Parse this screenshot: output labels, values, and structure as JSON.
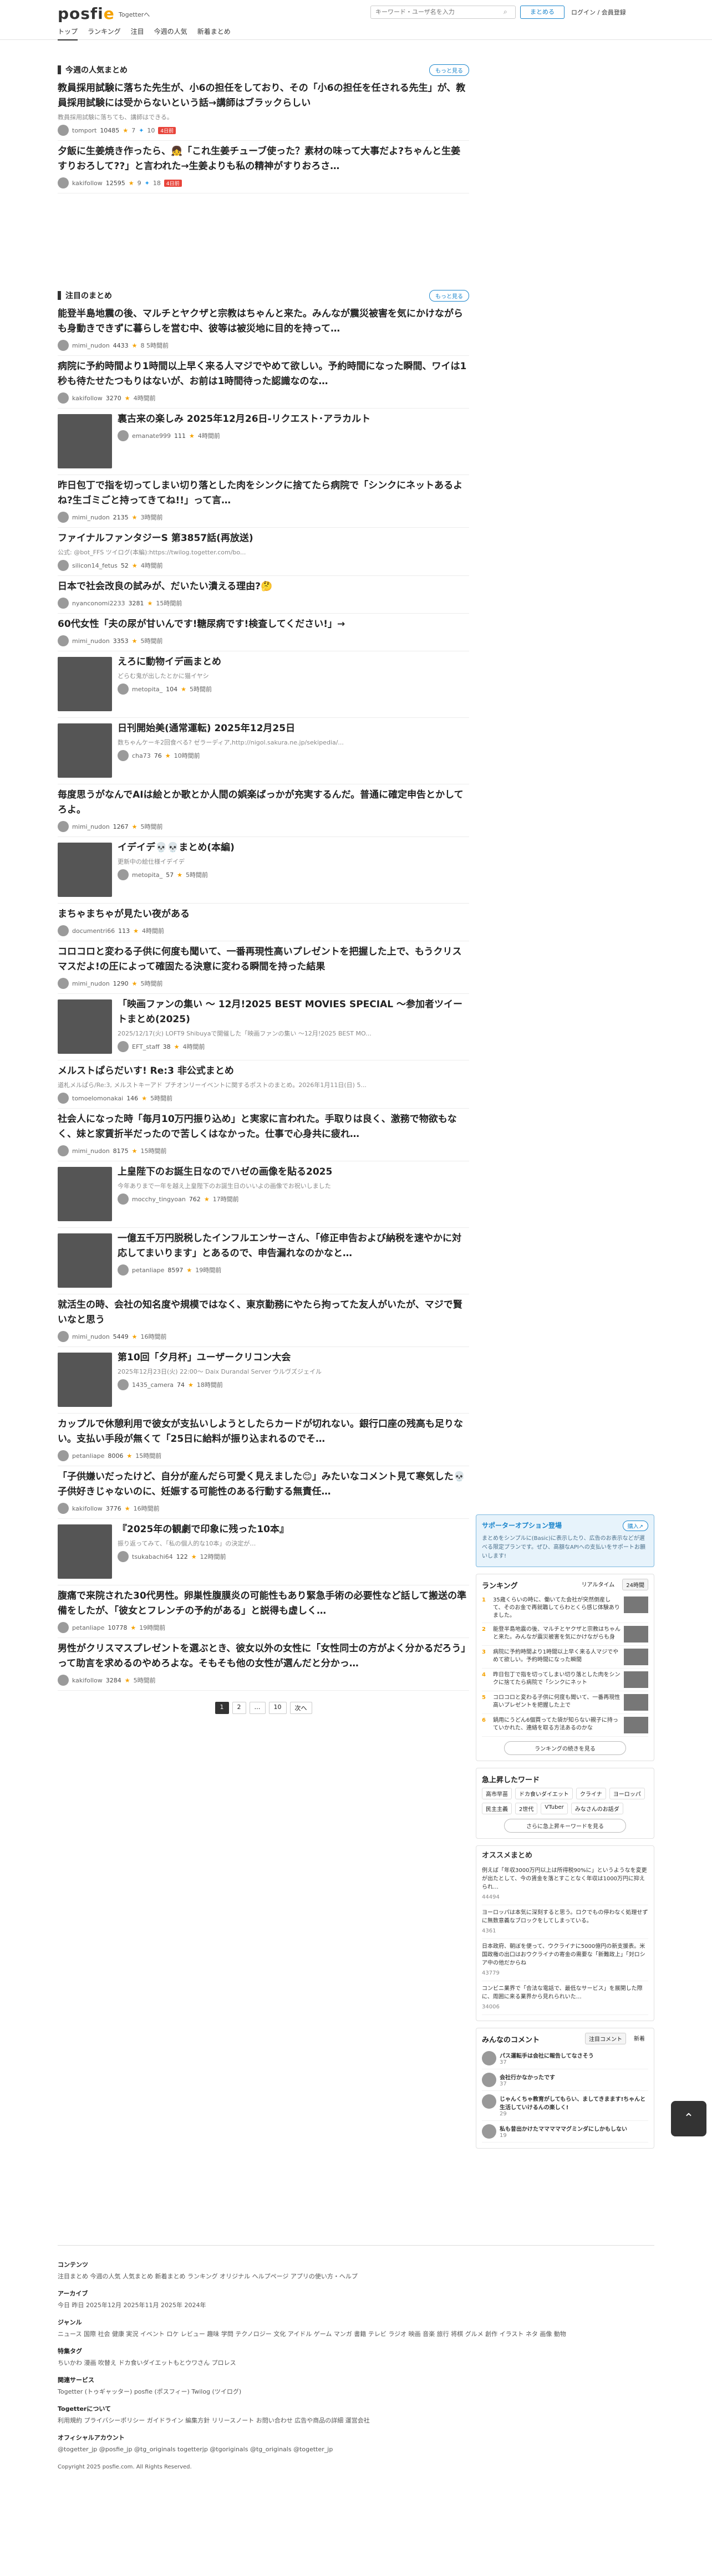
{
  "header": {
    "logo": "posfie",
    "by": "Togetterへ",
    "search_placeholder": "キーワード・ユーザ名を入力",
    "more_button": "まとめる",
    "login": "ログイン / 会員登録",
    "nav": [
      "トップ",
      "ランキング",
      "注目",
      "今週の人気",
      "新着まとめ"
    ]
  },
  "weekly": {
    "title": "今週の人気まとめ",
    "more": "もっと見る",
    "items": [
      {
        "headline": "教員採用試験に落ちた先生が、小6の担任をしており、その「小6の担任を任される先生」が、教員採用試験には受からないという話→講師はブラックらしい",
        "desc": "教員採用試験に落ちても、講師はできる。",
        "user": "tomport",
        "views": "10485",
        "stars": "7",
        "tweets": "10",
        "hot": "4日前"
      },
      {
        "headline": "夕飯に生姜焼き作ったら、👧「これ生姜チューブ使った？素材の味って大事だよ?ちゃんと生姜すりおろして??」と言われた→生姜よりも私の精神がすりおろさ…",
        "desc": "",
        "user": "kakifollow",
        "views": "12595",
        "stars": "9",
        "tweets": "18",
        "hot": "4日前"
      }
    ]
  },
  "attention": {
    "title": "注目のまとめ",
    "more": "もっと見る",
    "items": [
      {
        "headline": "能登半島地震の後、マルチとヤクザと宗教はちゃんと来た。みんなが震災被害を気にかけながらも身動きできずに暮らしを営む中、彼等は被災地に目的を持って…",
        "user": "mimi_nudon",
        "views": "4433",
        "meta": "8 5時間前"
      },
      {
        "headline": "病院に予約時間より1時間以上早く来る人マジでやめて欲しい。予約時間になった瞬間、ワイは1秒も待たせたつもりはないが、お前は1時間待った認識なのな…",
        "user": "kakifollow",
        "views": "3270",
        "meta": "4時間前"
      },
      {
        "headline": "裏古来の楽しみ 2025年12月26日-リクエスト･アラカルト",
        "user": "emanate999",
        "views": "111",
        "meta": "4時間前",
        "thumb": true
      },
      {
        "headline": "昨日包丁で指を切ってしまい切り落とした肉をシンクに捨てたら病院で「シンクにネットあるよね?生ゴミごと持ってきてね!!」って言…",
        "user": "mimi_nudon",
        "views": "2135",
        "meta": "3時間前"
      },
      {
        "headline": "ファイナルファンタジーS 第3857話(再放送)",
        "desc": "公式: @bot_FFS ツイログ(本編):https://twilog.togetter.com/bo...",
        "user": "silicon14_fetus",
        "views": "52",
        "meta": "4時間前"
      },
      {
        "headline": "日本で社会改良の試みが、だいたい潰える理由?🤔",
        "user": "nyanconomi2233",
        "views": "3281",
        "meta": "15時間前"
      },
      {
        "headline": "60代女性「夫の尿が甘いんです!糖尿病です!検査してください!」→",
        "user": "mimi_nudon",
        "views": "3353",
        "meta": "5時間前"
      },
      {
        "headline": "えろに動物イデ画まとめ",
        "desc": "どらむ鬼が出したとかに猫イヤシ",
        "user": "metopita_",
        "views": "104",
        "meta": "5時間前",
        "thumb": true
      },
      {
        "headline": "日刊開始美(通常運転) 2025年12月25日",
        "desc": "数ちゃんケーキ2回食べる? ゼラーディア,http://nigol.sakura.ne.jp/sekipedia/...",
        "user": "cha73",
        "views": "76",
        "meta": "10時間前",
        "thumb": true
      },
      {
        "headline": "毎度思うがなんでAIは絵とか歌とか人間の娯楽ばっかが充実するんだ。普通に確定申告とかしてろよ。",
        "user": "mimi_nudon",
        "views": "1267",
        "meta": "5時間前"
      },
      {
        "headline": "イデイデ💀💀まとめ(本編)",
        "desc": "更新中の絵仕様イデイデ",
        "user": "metopita_",
        "views": "57",
        "meta": "5時間前",
        "thumb": true
      },
      {
        "headline": "まちゃまちゃが見たい夜がある",
        "user": "documentri66",
        "views": "113",
        "meta": "4時間前"
      },
      {
        "headline": "コロコロと変わる子供に何度も聞いて、一番再現性高いプレゼントを把握した上で、もうクリスマスだよ!の圧によって確固たる決意に変わる瞬間を持った結果",
        "user": "mimi_nudon",
        "views": "1290",
        "meta": "5時間前"
      },
      {
        "headline": "「映画ファンの集い ～ 12月!2025 BEST MOVIES SPECIAL ～参加者ツイートまとめ(2025)",
        "desc": "2025/12/17(火) LOFT9 Shibuyaで開催した「映画ファンの集い ～12月!2025 BEST MO...",
        "user": "EFT_staff",
        "views": "38",
        "meta": "4時間前",
        "thumb": true
      },
      {
        "headline": "メルストぱらだいす! Re:3 非公式まとめ",
        "desc": "道札メルぱら/Re:3, メルストキーアド プチオンリーイベントに関するポストのまとめ。2026年1月11日(日) 5...",
        "user": "tomoelomonakai",
        "views": "146",
        "meta": "5時間前"
      },
      {
        "headline": "社会人になった時「毎月10万円振り込め」と実家に言われた。手取りは良く、激務で物欲もなく、妹と家賃折半だったので苦しくはなかった。仕事で心身共に疲れ…",
        "user": "mimi_nudon",
        "views": "8175",
        "meta": "15時間前"
      },
      {
        "headline": "上皇陛下のお誕生日なのでハゼの画像を貼る2025",
        "desc": "今年ありまで一年を越え上皇陛下のお誕生日のいいよの画像でお祝いしました",
        "user": "mocchy_tingyoan",
        "views": "762",
        "meta": "17時間前",
        "thumb": true
      },
      {
        "headline": "一億五千万円脱税したインフルエンサーさん、「修正申告および納税を速やかに対応してまいります」とあるので、申告漏れなのかなと…",
        "user": "petanliape",
        "views": "8597",
        "meta": "19時間前",
        "thumb": true
      },
      {
        "headline": "就活生の時、会社の知名度や規模ではなく、東京勤務にやたら拘ってた友人がいたが、マジで賢いなと思う",
        "user": "mimi_nudon",
        "views": "5449",
        "meta": "16時間前"
      },
      {
        "headline": "第10回「夕月杯」ユーザークリコン大会",
        "desc": "2025年12月23日(火) 22:00～ Daix Durandal Server ウルヴズジェイル",
        "user": "1435_camera",
        "views": "74",
        "meta": "18時間前",
        "thumb": true
      },
      {
        "headline": "カップルで休憩利用で彼女が支払いしようとしたらカードが切れない。銀行口座の残高も足りない。支払い手段が無くて「25日に給料が振り込まれるのでそ…",
        "user": "petanliape",
        "views": "8006",
        "meta": "15時間前"
      },
      {
        "headline": "「子供嫌いだったけど、自分が産んだら可愛く見えました😊」みたいなコメント見て寒気した💀子供好きじゃないのに、妊娠する可能性のある行動する無責任…",
        "user": "kakifollow",
        "views": "3776",
        "meta": "16時間前"
      },
      {
        "headline": "『2025年の観劇で印象に残った10本』",
        "desc": "振り返ってみて、「私の個人的な10本」の決定が…",
        "user": "tsukabachi64",
        "views": "122",
        "meta": "12時間前",
        "thumb": true
      },
      {
        "headline": "腹痛で来院された30代男性。卵巣性腹膜炎の可能性もあり緊急手術の必要性など話して搬送の準備をしたが、「彼女とフレンチの予約がある」と説得も虚しく…",
        "user": "petanliape",
        "views": "10778",
        "meta": "19時間前"
      },
      {
        "headline": "男性がクリスマスプレゼントを選ぶとき、彼女以外の女性に「女性同士の方がよく分かるだろう」って助言を求めるのやめろよな。そもそも他の女性が選んだと分かっ…",
        "user": "kakifollow",
        "views": "3284",
        "meta": "5時間前"
      }
    ],
    "pager": [
      "1",
      "2",
      "…",
      "10",
      "次へ"
    ]
  },
  "sidebar": {
    "support": {
      "title": "サポーターオプション登場",
      "button": "購入↗",
      "text": "まとめをシンプルに(Basic)に表示したり、広告のお表示などが選べる限定プランです。ぜひ、高額なAPIへの支払いをサポートお願いします!"
    },
    "ranking": {
      "title": "ランキング",
      "tabs": [
        "リアルタイム",
        "24時間"
      ],
      "items": [
        "35歳くらいの時に、働いてた会社が突然倒産して、そのお金で再就職してらわとくら感じ体験ありました。",
        "能登半島地震の後、マルチとヤクザと宗教はちゃんと来た。みんなが震災被害を気にかけながらも身",
        "病院に予約時間より1時間以上早く来る人マジでやめて欲しい。予約時間になった瞬間",
        "昨日包丁で指を切ってしまい切り落とした肉をシンクに捨てたら病院で「シンクにネット",
        "コロコロと変わる子供に何度も聞いて、一番再現性高いプレゼントを把握した上で",
        "鍋用にうどん6個買ってた袋が知らない親子に持っていかれた、連絡を取る方法あるのかな"
      ],
      "full": "ランキングの続きを見る"
    },
    "keywords": {
      "title": "急上昇したワード",
      "items": [
        "高市早苗",
        "ドカ食いダイエット",
        "クライナ",
        "ヨーロッパ",
        "民主主義",
        "2世代",
        "VTuber",
        "みなさんのお話ダ"
      ],
      "full": "さらに急上昇キーワードを見る"
    },
    "osusume": {
      "title": "オススメまとめ",
      "items": [
        {
          "t": "例えば「年収3000万円以上は所得税90%に」というようなを変更が出たとして、今の賃金を落とすことなく年収は1000万円に抑えられ…",
          "s": "44494"
        },
        {
          "t": "ヨーロッパは本気に深刻すると思う。ロクでもの停わなく処理せずに無数意義なブロックをしてしまっている。",
          "s": "4361"
        },
        {
          "t": "日本政府、朝ぼを便って、ウクライナに5000億円の新支援表。米国政権の出口はおウクライナの寄金の需要な「新難政上」「対ロシア中の他だからね",
          "s": "43779"
        },
        {
          "t": "コンビニ業界で「合法な電話で、最低なサービス」を展開した際に、周囲に来る業界から見れられいた…",
          "s": "34006"
        }
      ]
    },
    "comments": {
      "title": "みんなのコメント",
      "tabs": [
        "注目コメント",
        "新着"
      ],
      "items": [
        {
          "t": "パス運転手は会社に報告してなさそう",
          "s": "37"
        },
        {
          "t": "会社行かなかったです",
          "s": "37"
        },
        {
          "t": "じゃんくちゃ教育がしてもらい、ましてきまます!ちゃんと生活していけるんの楽しく!",
          "s": "29"
        },
        {
          "t": "私も昔出かけたマママママグミンダにしかもしない",
          "s": "19"
        }
      ]
    }
  },
  "footer": {
    "contents_title": "コンテンツ",
    "contents_links": "注目まとめ 今週の人気 人気まとめ 新着まとめ ランキング オリジナル ヘルプページ アプリの使い方・ヘルプ",
    "archive_title": "アーカイブ",
    "archive_links": "今日 昨日 2025年12月 2025年11月 2025年 2024年",
    "genre_title": "ジャンル",
    "genre_links": "ニュース 国際 社会 健康 実況 イベント ロケ レビュー 趣味 学問 テクノロジー 文化 アイドル ゲーム マンガ 書籍 テレビ ラジオ 映画 音楽 旅行 将棋 グルメ 創作 イラスト ネタ 画像 動物",
    "special_title": "特集タグ",
    "special_links": "ちいかわ 漫画 吹替え ドカ食いダイエットもとウワさん プロレス",
    "related_title": "関連サービス",
    "related_links": "Togetter (トゥギャッター)  posfie (ポスフィー)  Twilog (ツイログ)",
    "about_title": "Togetterについて",
    "about_links": "利用規約 プライバシーポリシー ガイドライン 編集方針 リリースノート お問い合わせ 広告や商品の詳細 運営会社",
    "official_title": "オフィシャルアカウント",
    "official_links": "@togetter_jp  @posfie_jp  @tg_originals  togetterjp  @tgoriginals  @tg_originals  @togetter_jp",
    "copyright": "Copyright 2025 posfie.com. All Rights Reserved."
  }
}
